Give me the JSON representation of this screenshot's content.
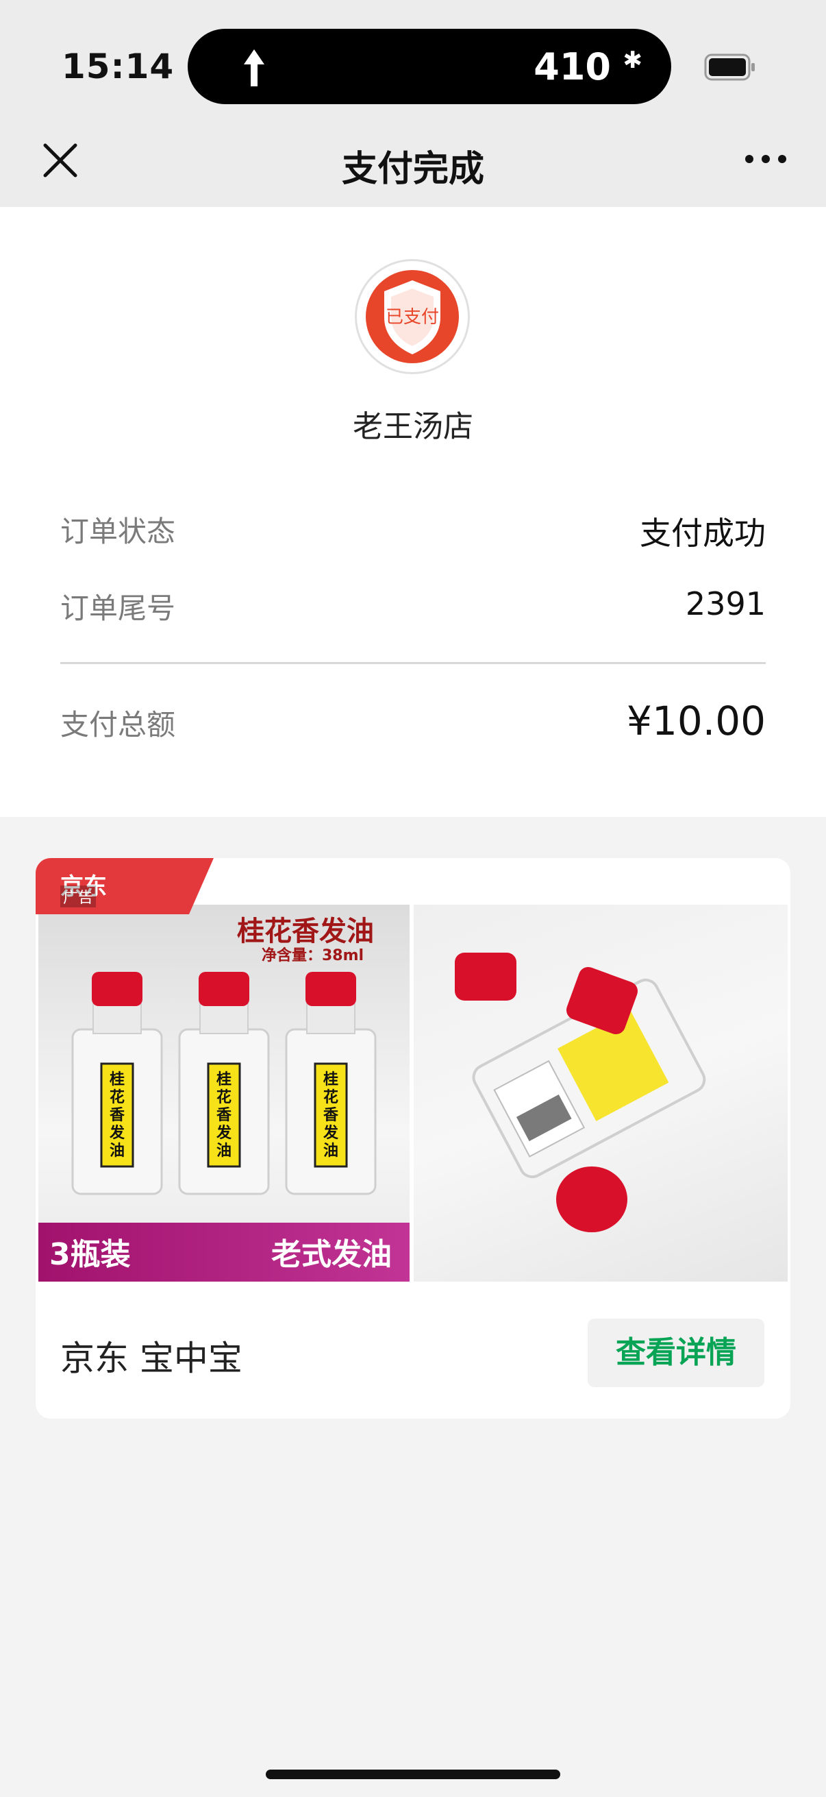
{
  "status_bar": {
    "time": "15:14",
    "island_value": "410",
    "island_symbol": "✱"
  },
  "nav": {
    "title": "支付完成"
  },
  "merchant": {
    "logo_text": "已支付",
    "name": "老王汤店"
  },
  "order": {
    "status_label": "订单状态",
    "status_value": "支付成功",
    "tail_label": "订单尾号",
    "tail_value": "2391",
    "total_label": "支付总额",
    "total_value": "¥10.00"
  },
  "ad": {
    "badge_text": "京东",
    "badge_tag": "广告",
    "image_title": "桂花香发油",
    "image_subtitle": "净含量：38ml",
    "bottle_label": "桂花香发油",
    "band_left": "3瓶装",
    "band_right": "老式发油",
    "footer_title": "京东 宝中宝",
    "detail_button": "查看详情"
  },
  "colors": {
    "accent_green": "#07a456",
    "brand_red": "#e4393c",
    "nav_bg": "#ececec",
    "page_bg": "#f3f3f3"
  }
}
